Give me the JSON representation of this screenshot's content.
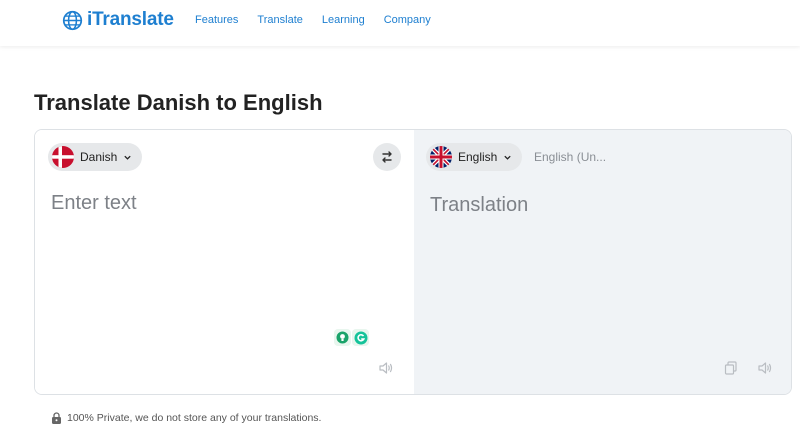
{
  "header": {
    "logo_text": "iTranslate",
    "nav": [
      "Features",
      "Translate",
      "Learning",
      "Company"
    ]
  },
  "page": {
    "title": "Translate Danish to English"
  },
  "translator": {
    "source_language": "Danish",
    "target_language": "English",
    "target_variant": "English (Un...",
    "input_placeholder": "Enter text",
    "output_placeholder": "Translation"
  },
  "footer": {
    "privacy_note": "100% Private, we do not store any of your translations."
  },
  "colors": {
    "brand": "#1e7fd0",
    "output_bg": "#f0f3f6",
    "pill_bg": "#e6e8ea"
  }
}
